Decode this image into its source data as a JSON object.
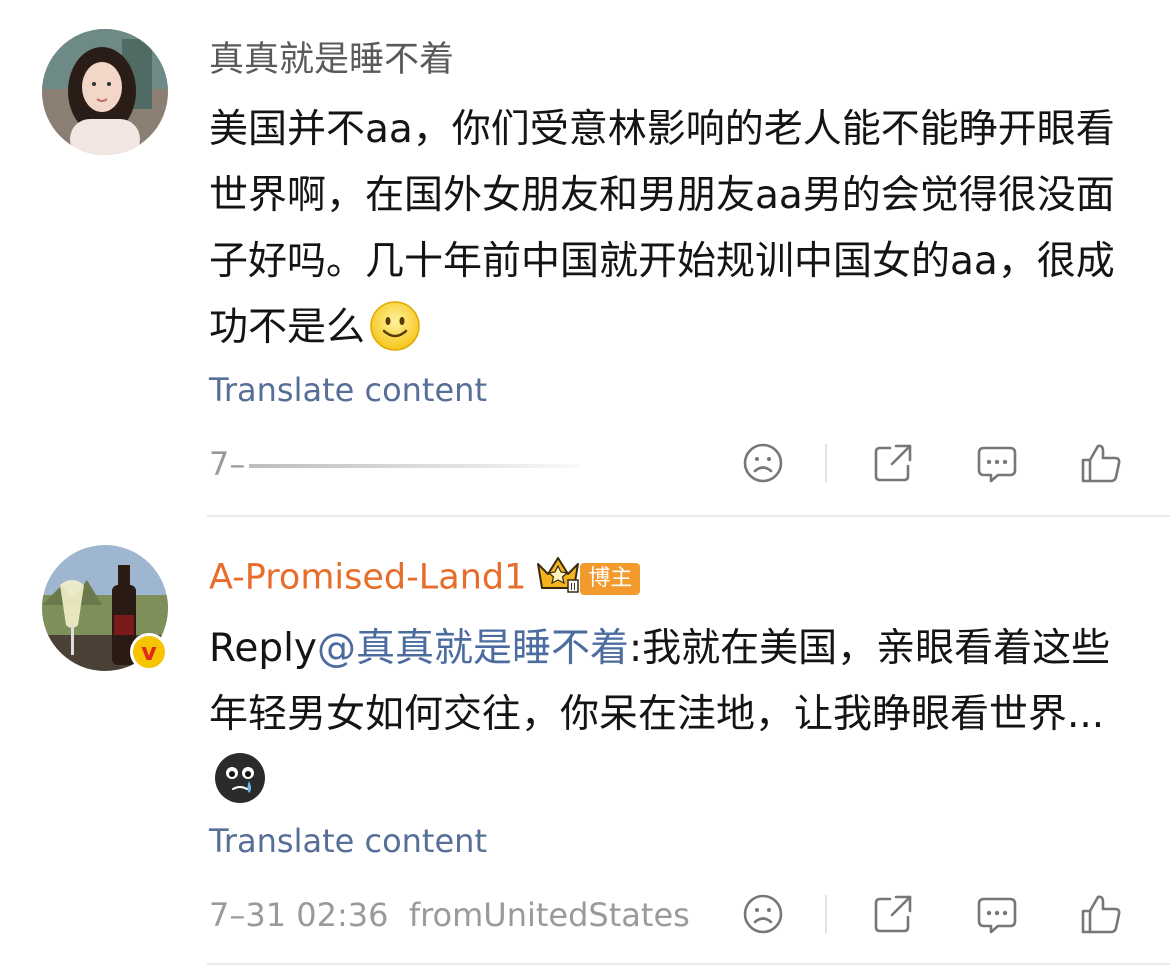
{
  "comments": [
    {
      "username": "真真就是睡不着",
      "body": "美国并不aa，你们受意林影响的老人能不能睁开眼看世界啊，在国外女朋友和男朋友aa男的会觉得很没面子好吗。几十年前中国就开始规训中国女的aa，很成功不是么",
      "emoji": "smile-emoji",
      "translate": "Translate content",
      "timestamp": "7–",
      "location": ""
    },
    {
      "username": "A-Promised-Land1",
      "badge": "博主",
      "reply_prefix": "Reply",
      "mention": "@真真就是睡不着",
      "body": ":我就在美国，亲眼看着这些年轻男女如何交往，你呆在洼地，让我睁眼看世界...",
      "emoji": "crying-emoji",
      "translate": "Translate content",
      "timestamp": "7–31 02:36",
      "location": "fromUnitedStates",
      "verified_badge": "v"
    }
  ],
  "icons": [
    "dislike-icon",
    "share-icon",
    "comment-icon",
    "like-icon"
  ],
  "colors": {
    "username_vip": "#e86d2a",
    "link": "#576f97",
    "mention": "#4c6ca0",
    "meta": "#9a9a9a",
    "badge": "#f39a2c"
  }
}
